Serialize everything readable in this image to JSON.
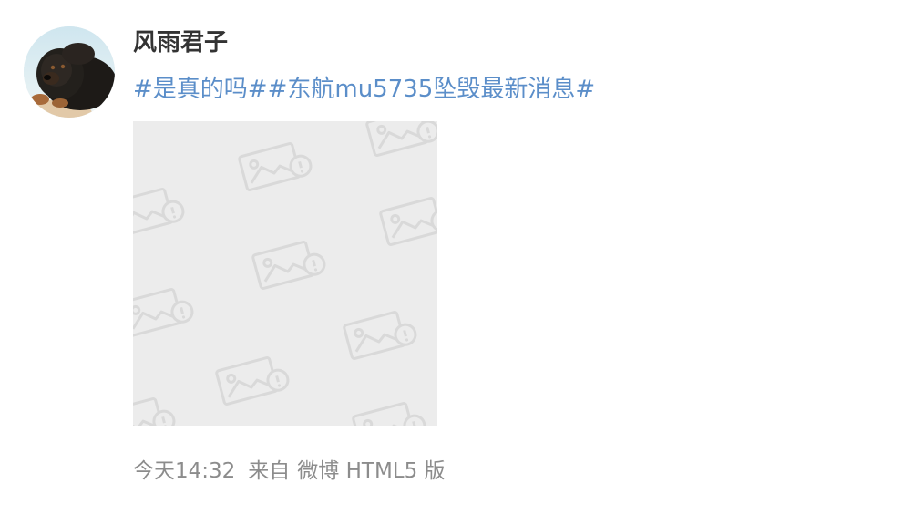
{
  "post": {
    "author": {
      "name": "风雨君子",
      "avatar_icon": "dog-avatar-icon"
    },
    "hashtags": [
      "#是真的吗#",
      "#东航mu5735坠毁最新消息#"
    ],
    "image": {
      "icon": "image-placeholder-icon",
      "background": "#ececec"
    },
    "timestamp": "今天14:32",
    "source_label": "来自",
    "source_name": "微博 HTML5 版"
  },
  "colors": {
    "link": "#5b8ec9",
    "username": "#333333",
    "meta": "#8c8c8c",
    "placeholder_icon": "#d9d9d9"
  }
}
